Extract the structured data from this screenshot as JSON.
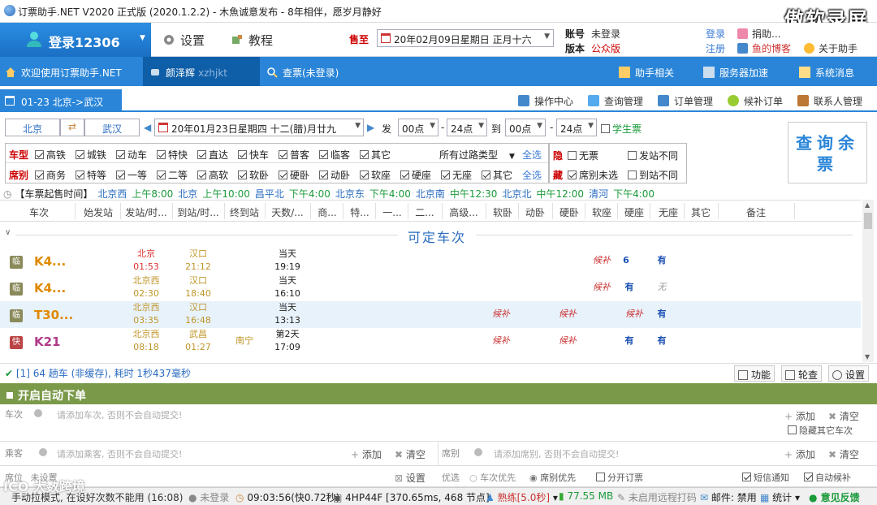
{
  "window": {
    "title": "订票助手.NET V2020 正式版 (2020.1.2.2) - 木魚诚意发布 - 8年相伴，愿岁月静好"
  },
  "watermark": "傲软录屏",
  "topbar": {
    "login_label": "登录12306",
    "settings_label": "设置",
    "tutorial_label": "教程",
    "depart_label": "售至",
    "depart_date": "20年02月09日星期日 正月十六",
    "account_label": "账号",
    "account_value": "未登录",
    "version_label": "版本",
    "version_value": "公众版",
    "login_link": "登录",
    "register_link": "注册",
    "right_items": [
      "捐助...",
      "鱼的博客",
      "关于助手"
    ]
  },
  "tabs": [
    {
      "label": "欢迎使用订票助手.NET"
    },
    {
      "label": "颜泽辉",
      "sub": "xzhjkt"
    },
    {
      "label": "查票(未登录)"
    }
  ],
  "tab_right": [
    "助手相关",
    "服务器加速",
    "系统消息"
  ],
  "route_tab": "01-23 北京->武汉",
  "route_tools": [
    "操作中心",
    "查询管理",
    "订单管理",
    "候补订单",
    "联系人管理"
  ],
  "query": {
    "from": "北京",
    "to": "武汉",
    "date": "20年01月23日星期四 十二(腊)月廿九",
    "fa": "发",
    "dep_start": "00点",
    "dep_end": "24点",
    "dao": "到",
    "arr_start": "00点",
    "arr_end": "24点",
    "student": "学生票",
    "search_button": "查询余票"
  },
  "filter": {
    "type_label": "车型",
    "types": [
      "高铁",
      "城铁",
      "动车",
      "特快",
      "直达",
      "快车",
      "普客",
      "临客",
      "其它"
    ],
    "route_type": "所有过路类型",
    "select_all": "全选",
    "seat_label": "席别",
    "seats": [
      "商务",
      "特等",
      "一等",
      "二等",
      "高软",
      "软卧",
      "硬卧",
      "动卧",
      "软座",
      "硬座",
      "无座",
      "其它"
    ],
    "hide_label": "隐",
    "hide_opts": [
      "无票",
      "发站不同"
    ],
    "hide2_label": "藏",
    "hide2_opts": [
      "席别未选",
      "到站不同"
    ]
  },
  "times": {
    "label": "【车票起售时间】",
    "items": [
      {
        "station": "北京西",
        "time": "上午8:00"
      },
      {
        "station": "北京",
        "time": "上午10:00"
      },
      {
        "station": "昌平北",
        "time": "下午4:00"
      },
      {
        "station": "北京东",
        "time": "下午4:00"
      },
      {
        "station": "北京南",
        "time": "中午12:30"
      },
      {
        "station": "北京北",
        "time": "中午12:00"
      },
      {
        "station": "清河",
        "time": "下午4:00"
      }
    ]
  },
  "grid": {
    "headers": [
      "车次",
      "始发站",
      "发站/时...",
      "到站/时...",
      "终到站",
      "天数/...",
      "商...",
      "特...",
      "一...",
      "二...",
      "高级...",
      "软卧",
      "动卧",
      "硬卧",
      "软座",
      "硬座",
      "无座",
      "其它",
      "备注"
    ],
    "section_title": "可定车次",
    "rows": [
      {
        "badge": "临",
        "no": "K4...",
        "from": "北京",
        "dep": "01:53",
        "to": "汉口",
        "arr": "21:12",
        "end": "",
        "day": "当天",
        "dur": "19:19",
        "rw": "",
        "dw": "",
        "yw": "",
        "rz": "候补",
        "yz": "6",
        "wz": "有"
      },
      {
        "badge": "临",
        "no": "K4...",
        "from": "北京西",
        "dep": "02:30",
        "to": "汉口",
        "arr": "18:40",
        "end": "",
        "day": "当天",
        "dur": "16:10",
        "rw": "",
        "dw": "",
        "yw": "",
        "rz": "候补",
        "yz": "有",
        "wz": "无"
      },
      {
        "badge": "临",
        "no": "T30...",
        "from": "北京西",
        "dep": "03:35",
        "to": "汉口",
        "arr": "16:48",
        "end": "",
        "day": "当天",
        "dur": "13:13",
        "rw": "候补",
        "dw": "",
        "yw": "候补",
        "rz": "",
        "yz": "候补",
        "wz": "有"
      },
      {
        "badge": "快",
        "no": "K21",
        "from": "北京西",
        "dep": "08:18",
        "to": "武昌",
        "arr": "01:27",
        "end": "南宁",
        "day": "第2天",
        "dur": "17:09",
        "rw": "候补",
        "dw": "",
        "yw": "候补",
        "rz": "",
        "yz": "有",
        "wz": "有"
      }
    ]
  },
  "status": {
    "message": "[1] 64 趟车 (非缓存), 耗时 1秒437毫秒",
    "buttons": [
      "功能",
      "轮查",
      "设置"
    ]
  },
  "auto": {
    "title": "开启自动下单",
    "train_label": "车次",
    "train_placeholder": "请添加车次, 否则不会自动提交!",
    "add": "添加",
    "clear": "清空",
    "hide_other": "隐藏其它车次",
    "passenger_label": "乘客",
    "passenger_placeholder": "请添加乘客, 否则不会自动提交!",
    "seat_label": "席别",
    "seat_placeholder": "请添加席别, 否则不会自动提交!",
    "position_label": "席位",
    "position_value": "未设置",
    "settings": "设置",
    "preference_label": "优选",
    "train_first": "车次优先",
    "seat_first": "席别优先",
    "split": "分开订票",
    "sms": "短信通知",
    "auto_hb": "自动候补"
  },
  "bottom": {
    "left": "手动拉模式, 在设好次数不能用 (16:08)",
    "login": "未登录",
    "time": "09:03:56(快0.72秒)",
    "node": "4HP44F [370.65ms, 468 节点]",
    "skill": "熟练[5.0秒]",
    "mem": "77.55 MB",
    "remote": "未启用远程打码",
    "mail": "邮件: 禁用",
    "stat": "统计",
    "feedback": "意见反馈"
  },
  "corner_watermark": "ICO 大数跨境",
  "colors": {
    "primary": "#2a85d8",
    "accent_red": "#cc0000",
    "green": "#7a9a4a"
  }
}
